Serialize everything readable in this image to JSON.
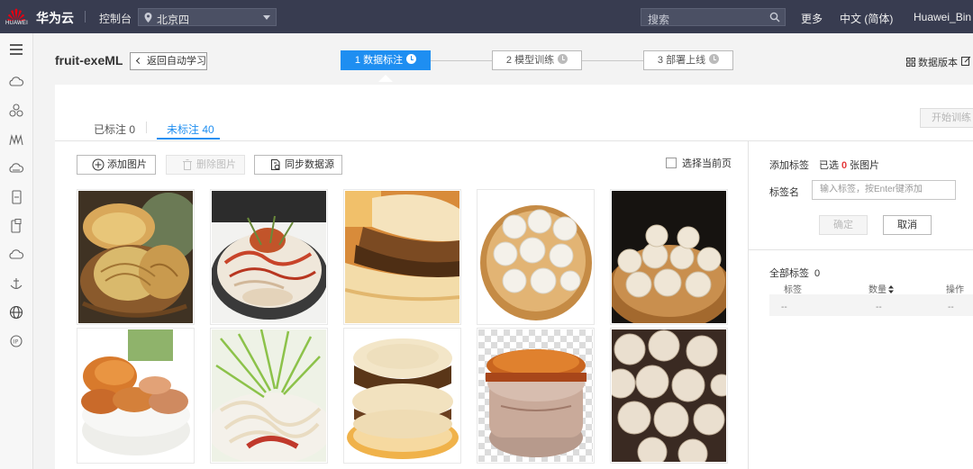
{
  "topbar": {
    "logo_text": "HUAWEI",
    "brand": "华为云",
    "console": "控制台",
    "region": "北京四",
    "search_placeholder": "搜索",
    "more": "更多",
    "language": "中文 (简体)",
    "user": "Huawei_Bin"
  },
  "sidenav": {
    "icons": [
      "menu-icon",
      "cloud-icon",
      "network-icon",
      "service-icon",
      "cloud-server-icon",
      "device-icon",
      "storage-icon",
      "cloud-upload-icon",
      "anchor-icon",
      "globe-icon",
      "ip-icon"
    ]
  },
  "header": {
    "project": "fruit-exeML",
    "back": "返回自动学习",
    "steps": [
      "1 数据标注",
      "2 模型训练",
      "3 部署上线"
    ],
    "data_version": "数据版本"
  },
  "tabs": {
    "labeled": "已标注 0",
    "unlabeled": "未标注 40",
    "start_training": "开始训练"
  },
  "toolbar": {
    "add_image": "添加图片",
    "delete_image": "删除图片",
    "sync_source": "同步数据源",
    "select_page": "选择当前页"
  },
  "images": [
    {
      "name": "roujiamo-basket"
    },
    {
      "name": "liangpi-chili"
    },
    {
      "name": "roujiamo-closeup"
    },
    {
      "name": "soup-dumplings-steamer"
    },
    {
      "name": "soup-dumplings-bamboo"
    },
    {
      "name": "dried-persimmon-bowl"
    },
    {
      "name": "liangpi-cucumber"
    },
    {
      "name": "roujiamo-plate"
    },
    {
      "name": "persimmon-cake"
    },
    {
      "name": "soup-dumplings-dark"
    }
  ],
  "label_panel": {
    "add_label": "添加标签",
    "selected_prefix": "已选",
    "selected_count": "0",
    "selected_suffix": "张图片",
    "label_name": "标签名",
    "input_placeholder": "输入标签，按Enter键添加",
    "confirm": "确定",
    "cancel": "取消",
    "all_labels": "全部标签",
    "all_count": "0",
    "col_label": "标签",
    "col_count": "数量",
    "col_action": "操作",
    "empty": "--"
  },
  "colors": {
    "topbar": "#383c50",
    "accent": "#1e8ef1",
    "warning_red": "#e4393c"
  }
}
